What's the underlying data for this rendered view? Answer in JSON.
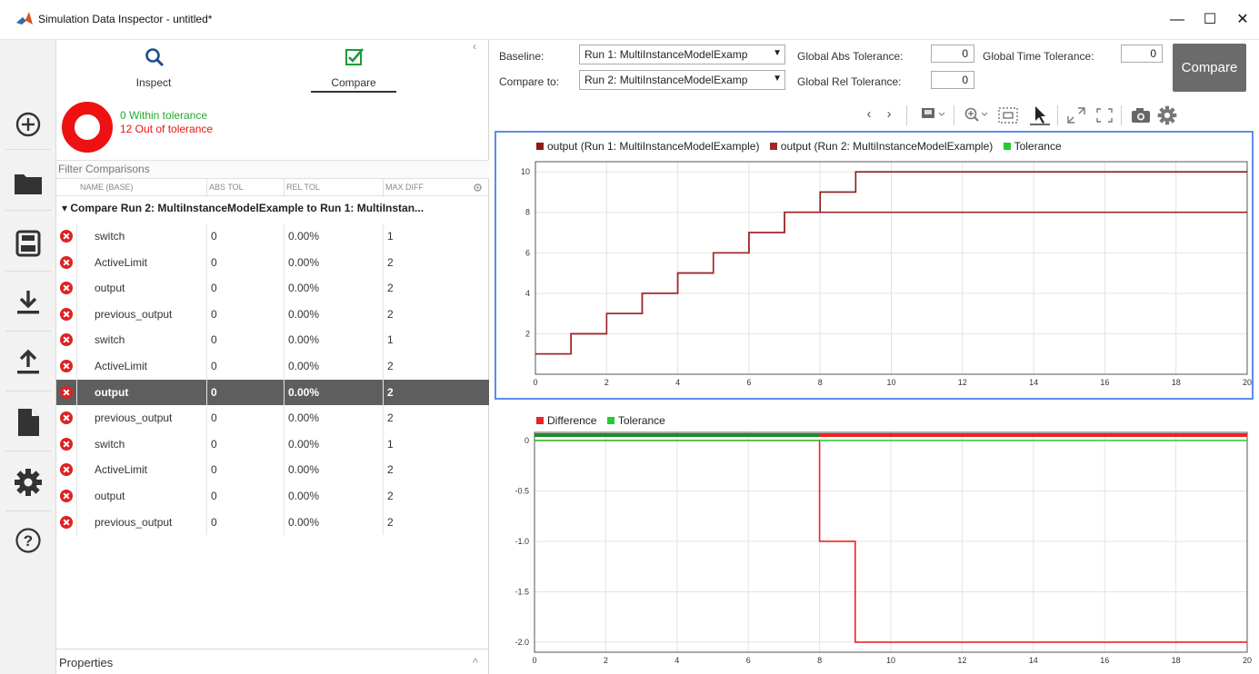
{
  "window": {
    "title": "Simulation Data Inspector - untitled*",
    "minimize": "—",
    "maximize": "☐",
    "close": "✕"
  },
  "left_toolbar": {
    "icons": [
      "add-icon",
      "folder-icon",
      "save-icon",
      "download-icon",
      "upload-icon",
      "document-icon",
      "gear-icon",
      "help-icon"
    ]
  },
  "mode_tabs": {
    "inspect_label": "Inspect",
    "compare_label": "Compare",
    "active": "Compare",
    "collapse": "‹"
  },
  "summary": {
    "within": "0 Within tolerance",
    "out": "12 Out of tolerance",
    "within_color": "#22aa33",
    "out_color": "#ee1111"
  },
  "filter": {
    "placeholder": "Filter Comparisons"
  },
  "columns": {
    "name": "NAME (BASE)",
    "abs": "ABS TOL",
    "rel": "REL TOL",
    "max": "MAX DIFF"
  },
  "group": {
    "label": "Compare Run 2: MultiInstanceModelExample to Run 1: MultiInstan..."
  },
  "rows": [
    {
      "name": "switch",
      "abs": "0",
      "rel": "0.00%",
      "max": "1",
      "selected": false
    },
    {
      "name": "ActiveLimit",
      "abs": "0",
      "rel": "0.00%",
      "max": "2",
      "selected": false
    },
    {
      "name": "output",
      "abs": "0",
      "rel": "0.00%",
      "max": "2",
      "selected": false
    },
    {
      "name": "previous_output",
      "abs": "0",
      "rel": "0.00%",
      "max": "2",
      "selected": false
    },
    {
      "name": "switch",
      "abs": "0",
      "rel": "0.00%",
      "max": "1",
      "selected": false
    },
    {
      "name": "ActiveLimit",
      "abs": "0",
      "rel": "0.00%",
      "max": "2",
      "selected": false
    },
    {
      "name": "output",
      "abs": "0",
      "rel": "0.00%",
      "max": "2",
      "selected": true
    },
    {
      "name": "previous_output",
      "abs": "0",
      "rel": "0.00%",
      "max": "2",
      "selected": false
    },
    {
      "name": "switch",
      "abs": "0",
      "rel": "0.00%",
      "max": "1",
      "selected": false
    },
    {
      "name": "ActiveLimit",
      "abs": "0",
      "rel": "0.00%",
      "max": "2",
      "selected": false
    },
    {
      "name": "output",
      "abs": "0",
      "rel": "0.00%",
      "max": "2",
      "selected": false
    },
    {
      "name": "previous_output",
      "abs": "0",
      "rel": "0.00%",
      "max": "2",
      "selected": false
    }
  ],
  "properties": {
    "label": "Properties",
    "chevron": "^"
  },
  "settings": {
    "baseline_label": "Baseline:",
    "baseline_value": "Run 1: MultiInstanceModelExamp",
    "compare_label": "Compare to:",
    "compare_value": "Run 2: MultiInstanceModelExamp",
    "dd_arrow": "▼",
    "abs_tol_label": "Global Abs Tolerance:",
    "abs_tol_value": "0",
    "rel_tol_label": "Global Rel Tolerance:",
    "rel_tol_value": "0",
    "time_tol_label": "Global Time Tolerance:",
    "time_tol_value": "0",
    "compare_button": "Compare"
  },
  "plot_toolbar": {
    "prev": "‹",
    "next": "›",
    "icons": [
      "layout-icon",
      "zoom-icon",
      "fit-icon",
      "cursor-icon",
      "expand-icon",
      "fullscreen-icon",
      "camera-icon",
      "settings-icon"
    ]
  },
  "chart_data": [
    {
      "type": "line",
      "title": "",
      "xlim": [
        0,
        20
      ],
      "ylim": [
        0,
        10.5
      ],
      "xticks": [
        0,
        2,
        4,
        6,
        8,
        10,
        12,
        14,
        16,
        18,
        20
      ],
      "yticks": [
        2,
        4,
        6,
        8,
        10
      ],
      "series": [
        {
          "name": "output (Run 1: MultiInstanceModelExample)",
          "color": "#8b1a1a",
          "step": true,
          "x": [
            0,
            1,
            2,
            3,
            4,
            5,
            6,
            7,
            8,
            9,
            20
          ],
          "y": [
            1,
            2,
            3,
            4,
            5,
            6,
            7,
            8,
            9,
            10,
            10
          ]
        },
        {
          "name": "output (Run 2: MultiInstanceModelExample)",
          "color": "#a0282c",
          "step": true,
          "x": [
            0,
            1,
            2,
            3,
            4,
            5,
            6,
            7,
            8,
            20
          ],
          "y": [
            1,
            2,
            3,
            4,
            5,
            6,
            7,
            8,
            8,
            8
          ]
        }
      ],
      "legend": [
        {
          "label": "output (Run 1: MultiInstanceModelExample)",
          "color": "#8b1a1a"
        },
        {
          "label": "output (Run 2: MultiInstanceModelExample)",
          "color": "#a0282c"
        },
        {
          "label": "Tolerance",
          "color": "#22cc33"
        }
      ],
      "legend_position": "top-left",
      "grid": true
    },
    {
      "type": "line",
      "title": "",
      "xlim": [
        0,
        20
      ],
      "ylim": [
        -2.1,
        0.08
      ],
      "xticks": [
        0,
        2,
        4,
        6,
        8,
        10,
        12,
        14,
        16,
        18,
        20
      ],
      "yticks": [
        0,
        -0.5,
        -1.0,
        -1.5,
        -2.0
      ],
      "ytick_labels": [
        "0",
        "-0.5",
        "-1.0",
        "-1.5",
        "-2.0"
      ],
      "series": [
        {
          "name": "Difference",
          "color": "#ee2222",
          "step": true,
          "x": [
            0,
            8,
            9,
            20
          ],
          "y": [
            0,
            -1,
            -2,
            -2
          ]
        },
        {
          "name": "Tolerance",
          "color": "#22cc33",
          "x": [
            0,
            20
          ],
          "y": [
            0,
            0
          ]
        }
      ],
      "legend": [
        {
          "label": "Difference",
          "color": "#ee2222"
        },
        {
          "label": "Tolerance",
          "color": "#22cc33"
        }
      ],
      "legend_position": "top-left",
      "grid": true
    }
  ]
}
